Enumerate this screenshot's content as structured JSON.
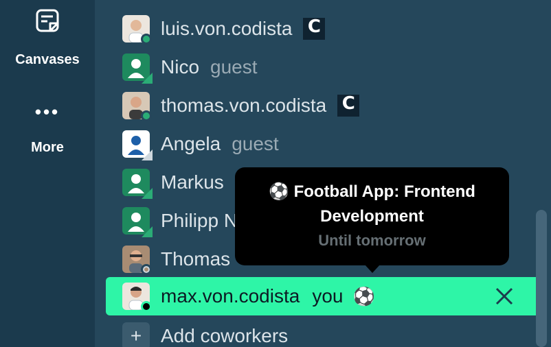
{
  "rail": {
    "canvases": {
      "label": "Canvases",
      "icon": "canvas-icon"
    },
    "more": {
      "label": "More",
      "dots": "•••"
    }
  },
  "members": [
    {
      "name": "luis.von.codista",
      "badge": "C",
      "status": "active",
      "avatar": "photo"
    },
    {
      "name": "Nico",
      "tag": "guest",
      "status": "active",
      "avatar": "guest-generic"
    },
    {
      "name": "thomas.von.codista",
      "badge": "C",
      "status": "active",
      "avatar": "photo"
    },
    {
      "name": "Angela",
      "tag": "guest",
      "status": "away",
      "avatar": "guest-blue"
    },
    {
      "name": "Markus",
      "status": "active",
      "avatar": "guest-generic"
    },
    {
      "name": "Philipp N",
      "status": "active",
      "avatar": "guest-generic"
    },
    {
      "name": "Thomas",
      "status": "away",
      "avatar": "photo"
    }
  ],
  "self": {
    "name": "max.von.codista",
    "you_label": "you",
    "status_emoji": "⚽"
  },
  "add": {
    "label": "Add coworkers",
    "symbol": "+"
  },
  "tooltip": {
    "line1": "⚽ Football App: Frontend",
    "line2": "Development",
    "line3": "Until tomorrow"
  },
  "colors": {
    "accent": "#2ef5a7",
    "background": "#25475b",
    "rail": "#1b3a4d",
    "presence": "#2bac76"
  }
}
